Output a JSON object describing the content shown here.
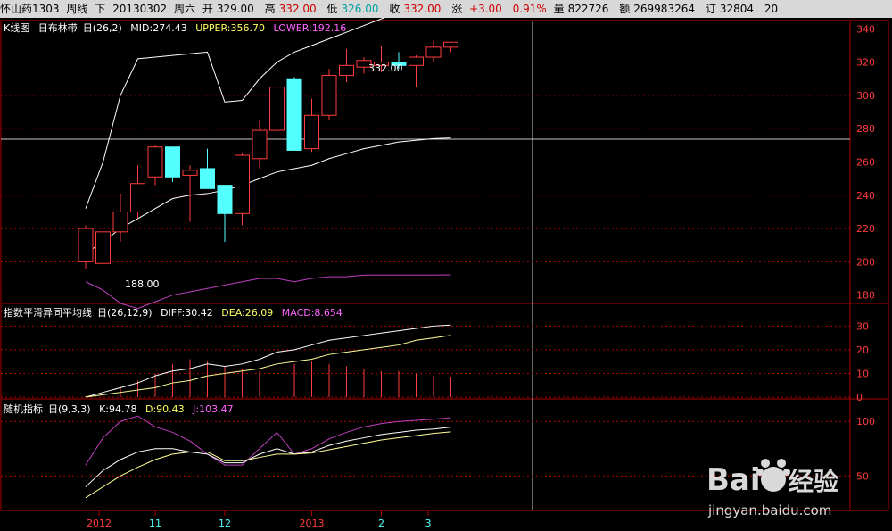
{
  "header": {
    "name": "怀山药1303",
    "period": "周线",
    "mode": "下",
    "date": "20130302",
    "weekday": "周六",
    "open_label": "开",
    "open": "329.00",
    "high_label": "高",
    "high": "332.00",
    "low_label": "低",
    "low": "326.00",
    "close_label": "收",
    "close": "332.00",
    "change_label": "涨",
    "change": "+3.00",
    "pct": "0.91%",
    "volume_label": "量",
    "volume": "822726",
    "amount_label": "额",
    "amount": "269983264",
    "oi_label": "订",
    "oi": "32804",
    "extra": "20"
  },
  "kline": {
    "title": "K线图",
    "indicator": "日布林带",
    "params": "日(26,2)",
    "mid": "MID:274.43",
    "upper": "UPPER:356.70",
    "lower": "LOWER:192.16",
    "annotation_high": "332.00",
    "annotation_low": "188.00",
    "y_ticks": [
      "340",
      "320",
      "300",
      "280",
      "260",
      "240",
      "220",
      "200",
      "180"
    ],
    "y_range": [
      175,
      345
    ]
  },
  "macd": {
    "title": "指数平滑异同平均线",
    "params": "日(26,12,9)",
    "diff": "DIFF:30.42",
    "dea": "DEA:26.09",
    "macd": "MACD:8.654",
    "y_ticks": [
      "30",
      "20",
      "10",
      "0"
    ]
  },
  "kdj": {
    "title": "随机指标",
    "params": "日(9,3,3)",
    "k": "K:94.78",
    "d": "D:90.43",
    "j": "J:103.47",
    "y_ticks": [
      "100",
      "50"
    ]
  },
  "x_axis": {
    "labels": [
      "2012",
      "11",
      "12",
      "2013",
      "2",
      "3"
    ]
  },
  "colors": {
    "up": "#ff3c3c",
    "down": "#54ffff",
    "grid": "#b00000",
    "mid_line": "#ffffff",
    "upper_line": "#ffff66",
    "lower_line": "#ff66ff"
  },
  "chart_data": {
    "type": "candlestick",
    "series": [
      {
        "o": 200,
        "h": 222,
        "l": 196,
        "c": 220
      },
      {
        "o": 199,
        "h": 227,
        "l": 188,
        "c": 218
      },
      {
        "o": 218,
        "h": 241,
        "l": 212,
        "c": 230
      },
      {
        "o": 230,
        "h": 258,
        "l": 226,
        "c": 247
      },
      {
        "o": 251,
        "h": 270,
        "l": 246,
        "c": 269
      },
      {
        "o": 269,
        "h": 268,
        "l": 248,
        "c": 251
      },
      {
        "o": 252,
        "h": 258,
        "l": 224,
        "c": 255
      },
      {
        "o": 256,
        "h": 268,
        "l": 244,
        "c": 244
      },
      {
        "o": 246,
        "h": 246,
        "l": 212,
        "c": 229
      },
      {
        "o": 229,
        "h": 265,
        "l": 222,
        "c": 264
      },
      {
        "o": 262,
        "h": 285,
        "l": 256,
        "c": 279
      },
      {
        "o": 279,
        "h": 311,
        "l": 274,
        "c": 305
      },
      {
        "o": 310,
        "h": 311,
        "l": 268,
        "c": 267
      },
      {
        "o": 268,
        "h": 298,
        "l": 266,
        "c": 288
      },
      {
        "o": 288,
        "h": 316,
        "l": 285,
        "c": 312
      },
      {
        "o": 312,
        "h": 328,
        "l": 308,
        "c": 318
      },
      {
        "o": 317,
        "h": 323,
        "l": 313,
        "c": 321
      },
      {
        "o": 318,
        "h": 330,
        "l": 314,
        "c": 320
      },
      {
        "o": 320,
        "h": 326,
        "l": 316,
        "c": 318
      },
      {
        "o": 318,
        "h": 324,
        "l": 305,
        "c": 323
      },
      {
        "o": 323,
        "h": 333,
        "l": 320,
        "c": 329
      },
      {
        "o": 329,
        "h": 332,
        "l": 326,
        "c": 332
      }
    ],
    "mid": [
      205,
      212,
      220,
      226,
      232,
      238,
      240,
      241,
      243,
      246,
      250,
      254,
      256,
      258,
      262,
      265,
      268,
      270,
      272,
      273,
      274,
      274.43
    ],
    "upper": [
      232,
      260,
      300,
      322,
      323,
      324,
      325,
      326,
      296,
      297,
      310,
      320,
      326,
      330,
      334,
      338,
      342,
      346,
      350,
      352,
      354,
      356.7
    ],
    "lower": [
      188,
      183,
      175,
      172,
      176,
      180,
      182,
      184,
      186,
      188,
      190,
      190,
      188,
      190,
      191,
      191,
      192,
      192,
      192,
      192,
      192,
      192.16
    ],
    "macd_hist": [
      0.5,
      2,
      4,
      7,
      10,
      14,
      16,
      15,
      13,
      12,
      11,
      13,
      14,
      15,
      14,
      13,
      12,
      11,
      11,
      10,
      9,
      8.654
    ],
    "diff": [
      0,
      2,
      4,
      6,
      9,
      11,
      12,
      14,
      13,
      14,
      16,
      19,
      20,
      22,
      24,
      25,
      26,
      27,
      28,
      29,
      30,
      30.42
    ],
    "dea": [
      0,
      1,
      2,
      3,
      4,
      6,
      7,
      9,
      10,
      11,
      12,
      14,
      15,
      16,
      18,
      19,
      20,
      21,
      22,
      24,
      25,
      26.09
    ],
    "k": [
      40,
      55,
      65,
      72,
      75,
      75,
      72,
      70,
      62,
      62,
      70,
      75,
      70,
      72,
      78,
      82,
      85,
      88,
      90,
      92,
      93,
      94.78
    ],
    "d": [
      30,
      40,
      50,
      58,
      65,
      70,
      72,
      72,
      64,
      64,
      67,
      70,
      70,
      71,
      74,
      77,
      80,
      83,
      85,
      87,
      89,
      90.43
    ],
    "j": [
      60,
      85,
      100,
      105,
      95,
      90,
      82,
      70,
      60,
      60,
      75,
      90,
      70,
      75,
      84,
      90,
      95,
      98,
      100,
      101,
      102,
      103.47
    ]
  }
}
